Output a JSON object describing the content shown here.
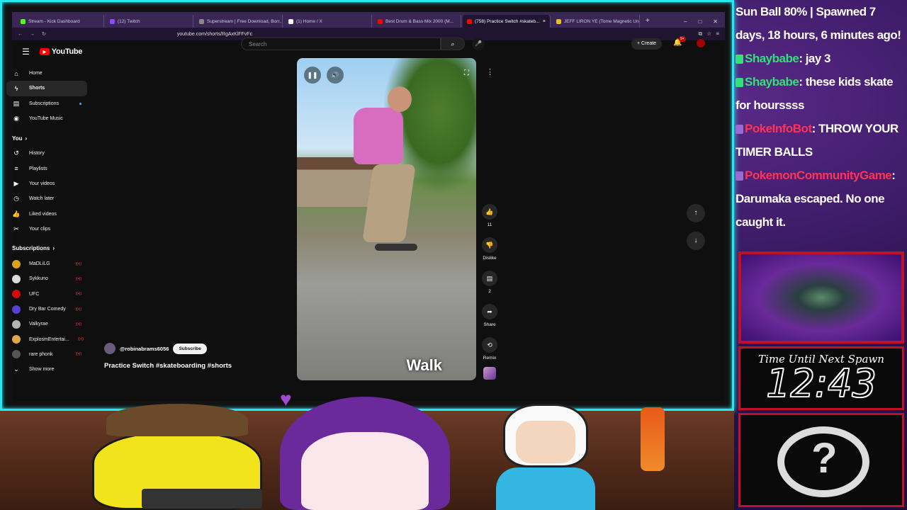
{
  "browser": {
    "tabs": [
      {
        "title": "Stream - Kick Dashboard",
        "color": "#53fc18",
        "active": false
      },
      {
        "title": "(12) Twitch",
        "color": "#9146ff",
        "active": false
      },
      {
        "title": "Superstream | Free Download, Borr...",
        "color": "#888888",
        "active": false
      },
      {
        "title": "(1) Home / X",
        "color": "#ffffff",
        "active": false
      },
      {
        "title": "Best Drum & Bass Mix 2000 (M...",
        "color": "#ff0000",
        "active": false
      },
      {
        "title": "(758) Practice Switch #skateb...",
        "color": "#ff0000",
        "active": true
      },
      {
        "title": "JEFF LIRON YE (Tome Magnetic Un...",
        "color": "#e8c020",
        "active": false
      }
    ],
    "url": "youtube.com/shorts/RgAxKlFFvFc",
    "new_tab_glyph": "+",
    "close_glyph": "×"
  },
  "youtube": {
    "logo_text": "YouTube",
    "search_placeholder": "Search",
    "create_label": "Create",
    "bell_badge": "9+",
    "sidebar_main": [
      {
        "label": "Home",
        "icon": "home-icon",
        "glyph": "⌂",
        "active": false
      },
      {
        "label": "Shorts",
        "icon": "shorts-icon",
        "glyph": "ϟ",
        "active": true
      },
      {
        "label": "Subscriptions",
        "icon": "subscriptions-icon",
        "glyph": "▤",
        "active": false,
        "dot": true
      },
      {
        "label": "YouTube Music",
        "icon": "music-icon",
        "glyph": "◉",
        "active": false
      }
    ],
    "you_section_label": "You",
    "sidebar_you": [
      {
        "label": "History",
        "icon": "history-icon",
        "glyph": "↺"
      },
      {
        "label": "Playlists",
        "icon": "playlists-icon",
        "glyph": "≡"
      },
      {
        "label": "Your videos",
        "icon": "your-videos-icon",
        "glyph": "▶"
      },
      {
        "label": "Watch later",
        "icon": "watch-later-icon",
        "glyph": "◷"
      },
      {
        "label": "Liked videos",
        "icon": "liked-icon",
        "glyph": "👍"
      },
      {
        "label": "Your clips",
        "icon": "clips-icon",
        "glyph": "✂"
      }
    ],
    "subscriptions_section_label": "Subscriptions",
    "subscriptions": [
      {
        "name": "MaDLiLG",
        "color": "#d9a21a"
      },
      {
        "name": "Sykkuno",
        "color": "#dddddd"
      },
      {
        "name": "UFC",
        "color": "#d20a0a"
      },
      {
        "name": "Dry Bar Comedy",
        "color": "#5a3fd0"
      },
      {
        "name": "Valkyrae",
        "color": "#b5b5b5"
      },
      {
        "name": "ExplosmEntertai...",
        "color": "#e0a84a"
      },
      {
        "name": "rare phonk",
        "color": "#555555"
      }
    ],
    "show_more_label": "Show more",
    "short": {
      "caption": "Walk",
      "channel": "@robinabrams6056",
      "subscribe_label": "Subscribe",
      "title": "Practice Switch #skateboarding #shorts",
      "likes": "11",
      "dislike_label": "Dislike",
      "comments": "2",
      "share_label": "Share",
      "remix_label": "Remix"
    }
  },
  "chat": [
    {
      "user": "",
      "text": "Sun Ball 80% | Spawned 7 days, 18 hours, 6 minutes ago!",
      "user_class": ""
    },
    {
      "user": "Shaybabe",
      "text": ": jay 3",
      "user_class": "uname-green",
      "badge": "K"
    },
    {
      "user": "Shaybabe",
      "text": ": these kids skate for hourssss",
      "user_class": "uname-green",
      "badge": "K"
    },
    {
      "user": "PokeInfoBot",
      "text": ": THROW YOUR TIMER BALLS",
      "user_class": "uname-red",
      "badge": "P"
    },
    {
      "user": "PokemonCommunityGame",
      "text": ": Darumaka escaped. No one caught it.",
      "user_class": "uname-red",
      "badge": "P"
    }
  ],
  "overlay": {
    "timer_label": "Time Until Next Spawn",
    "timer_value": "12:43"
  }
}
